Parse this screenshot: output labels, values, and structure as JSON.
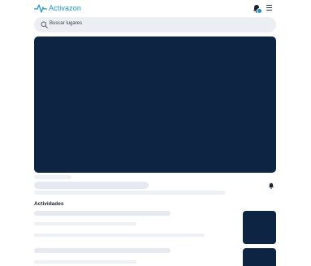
{
  "header": {
    "brand": "Activazon",
    "brand_color": "#1e93c9",
    "logo_icon": "pulse-icon",
    "notification_icon": "bell-icon",
    "menu_icon": "hamburger-icon"
  },
  "search": {
    "placeholder": "Buscar lugares",
    "icon": "search-icon"
  },
  "hero": {
    "background": "#0d2442"
  },
  "place": {
    "notification_icon": "bell-icon"
  },
  "activities": {
    "title": "Actividades",
    "items": [
      {
        "thumb_color": "#0d2442"
      },
      {
        "thumb_color": "#0d2442"
      }
    ]
  }
}
